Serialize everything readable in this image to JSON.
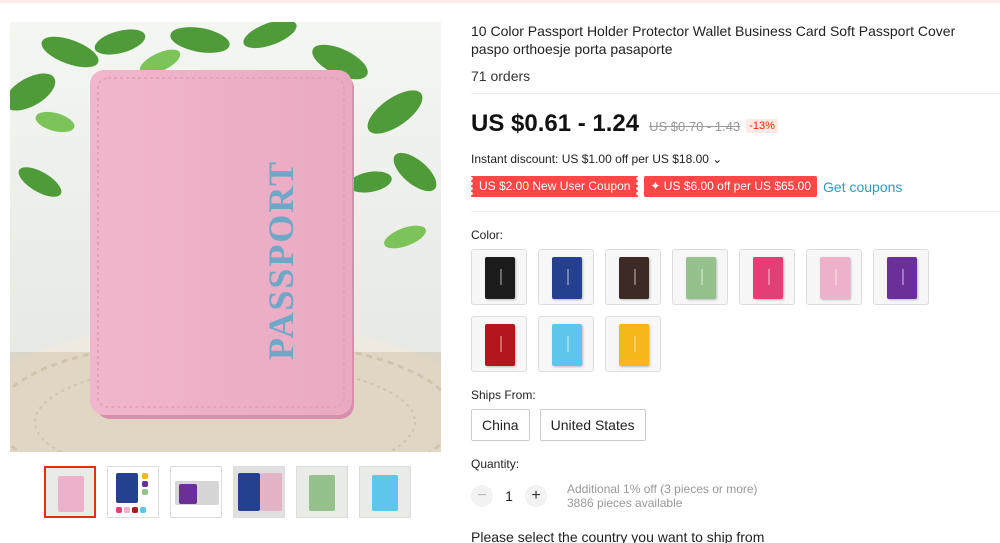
{
  "product": {
    "title": "10 Color Passport Holder Protector Wallet Business Card Soft Passport Cover paspo orthoesje porta pasaporte",
    "orders": "71 orders",
    "price": "US $0.61 - 1.24",
    "old_price": "US $0.70 - 1.43",
    "discount_pct": "-13%",
    "instant_discount": "Instant discount: US $1.00 off per US $18.00 ⌄",
    "coupon_new_user": "US $2.00 New User Coupon",
    "coupon_store": "✦ US $6.00 off per US $65.00",
    "get_coupons": "Get coupons",
    "image_text": "PASSPORT"
  },
  "color": {
    "label": "Color:",
    "options": [
      {
        "name": "black",
        "hex": "#1c1c1c"
      },
      {
        "name": "navy",
        "hex": "#24408f"
      },
      {
        "name": "brown",
        "hex": "#3e2a25"
      },
      {
        "name": "green",
        "hex": "#95c28c"
      },
      {
        "name": "rose",
        "hex": "#e43e77"
      },
      {
        "name": "pink",
        "hex": "#eeb1cb"
      },
      {
        "name": "purple",
        "hex": "#6a2f98"
      },
      {
        "name": "red",
        "hex": "#b5161e"
      },
      {
        "name": "sky-blue",
        "hex": "#5ec6ea"
      },
      {
        "name": "yellow",
        "hex": "#f6b71a"
      }
    ]
  },
  "ships_from": {
    "label": "Ships From:",
    "options": [
      "China",
      "United States"
    ]
  },
  "quantity": {
    "label": "Quantity:",
    "minus": "−",
    "value": "1",
    "plus": "+",
    "note_line1": "Additional 1% off (3 pieces or more)",
    "note_line2": "3886 pieces available"
  },
  "shipping_message": "Please select the country you want to ship from",
  "thumbnails": [
    {
      "name": "pink",
      "bg": "#e9ece6",
      "color": "#eeb1cb"
    },
    {
      "name": "multi",
      "bg": "#ffffff",
      "color": "#24408f"
    },
    {
      "name": "purple",
      "bg": "#ffffff",
      "color": "#6a2f98"
    },
    {
      "name": "navy",
      "bg": "#d9d9d9",
      "color": "#24408f"
    },
    {
      "name": "green",
      "bg": "#e9ece6",
      "color": "#95c28c"
    },
    {
      "name": "sky-blue",
      "bg": "#e9ece6",
      "color": "#5ec6ea"
    }
  ],
  "colors": {
    "accent": "#e62e04",
    "coupon": "#ff4747",
    "link": "#2e9cc3"
  }
}
